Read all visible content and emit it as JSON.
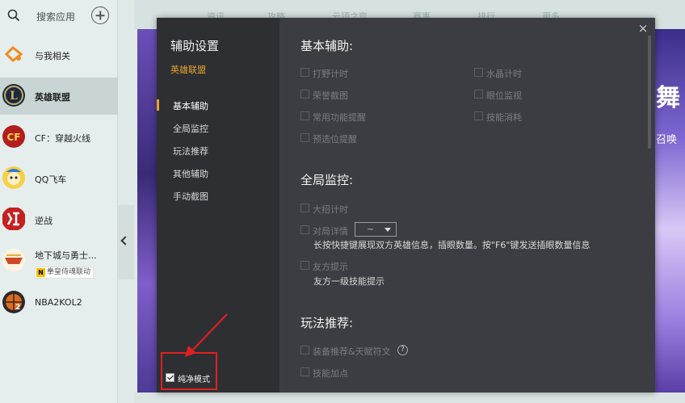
{
  "sidebar": {
    "search_label": "搜索应用",
    "games": [
      {
        "label": "与我相关"
      },
      {
        "label": "英雄联盟"
      },
      {
        "label": "CF：穿越火线"
      },
      {
        "label": "QQ飞车"
      },
      {
        "label": "逆战"
      },
      {
        "label": "地下城与勇士...",
        "badge": "拳皇侍魂联动",
        "badge_letter": "N"
      },
      {
        "label": "NBA2KOL2"
      }
    ]
  },
  "background_tabs": [
    "资讯",
    "攻略",
    "云顶之弈",
    "赛事",
    "排行",
    "更多"
  ],
  "background_art": {
    "title_char": "舞",
    "subtitle": "召唤"
  },
  "modal": {
    "title": "辅助设置",
    "subtitle": "英雄联盟",
    "close_symbol": "×",
    "nav": [
      "基本辅助",
      "全局监控",
      "玩法推荐",
      "其他辅助",
      "手动截图"
    ],
    "pure_mode_label": "纯净模式",
    "pure_mode_checked": true,
    "sections": {
      "basic": {
        "title": "基本辅助:",
        "options_left": [
          "打野计时",
          "荣誉截图",
          "常用功能提醒",
          "预选位提醒"
        ],
        "options_right": [
          "水晶计时",
          "眼位监视",
          "技能消耗"
        ]
      },
      "global": {
        "title": "全局监控:",
        "ult_timer": "大招计时",
        "match_detail": "对局详情",
        "dropdown_value": "~",
        "match_detail_desc": "长按快捷键展现双方英雄信息，插眼数量。按\"F6\"键发送插眼数量信息",
        "ally_tip": "友方提示",
        "ally_tip_desc": "友方一级技能提示"
      },
      "recommend": {
        "title": "玩法推荐:",
        "equip": "装备推荐&天赋符文",
        "help_symbol": "?",
        "skill": "技能加点"
      }
    }
  },
  "colors": {
    "accent": "#e8a52a",
    "highlight_box": "#e02020",
    "modal_bg": "#3c3d42",
    "nav_bg": "#2e2f33"
  }
}
